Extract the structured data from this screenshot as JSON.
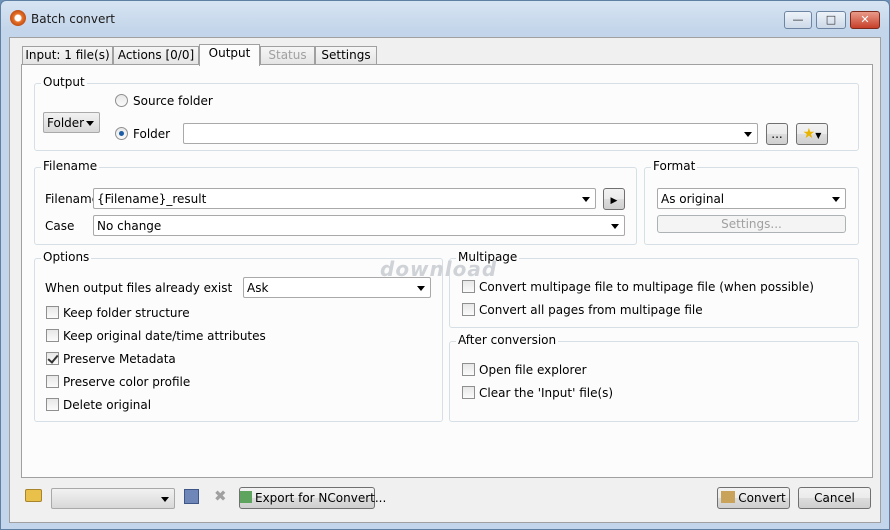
{
  "window": {
    "title": "Batch convert"
  },
  "tabs": [
    {
      "label": "Input: 1 file(s)"
    },
    {
      "label": "Actions [0/0]"
    },
    {
      "label": "Output"
    },
    {
      "label": "Status"
    },
    {
      "label": "Settings"
    }
  ],
  "output": {
    "legend": "Output",
    "type_value": "Folder",
    "source_folder_label": "Source folder",
    "folder_label": "Folder",
    "folder_value": "",
    "browse_label": "..."
  },
  "filename": {
    "legend": "Filename",
    "filename_label": "Filename",
    "filename_value": "{Filename}_result",
    "case_label": "Case",
    "case_value": "No change"
  },
  "format": {
    "legend": "Format",
    "value": "As original",
    "settings_label": "Settings..."
  },
  "options": {
    "legend": "Options",
    "exist_label": "When output files already exist",
    "exist_value": "Ask",
    "checkboxes": [
      {
        "label": "Keep folder structure",
        "checked": false
      },
      {
        "label": "Keep original date/time attributes",
        "checked": false
      },
      {
        "label": "Preserve Metadata",
        "checked": true
      },
      {
        "label": "Preserve color profile",
        "checked": false
      },
      {
        "label": "Delete original",
        "checked": false
      }
    ]
  },
  "multipage": {
    "legend": "Multipage",
    "checkboxes": [
      {
        "label": "Convert multipage file to multipage file (when possible)",
        "checked": false
      },
      {
        "label": "Convert all pages from multipage file",
        "checked": false
      }
    ]
  },
  "after": {
    "legend": "After conversion",
    "checkboxes": [
      {
        "label": "Open file explorer",
        "checked": false
      },
      {
        "label": "Clear the 'Input' file(s)",
        "checked": false
      }
    ]
  },
  "watermark": "download",
  "bottom": {
    "preset_value": "",
    "export_label": "Export for NConvert...",
    "convert_label": "Convert",
    "cancel_label": "Cancel"
  }
}
